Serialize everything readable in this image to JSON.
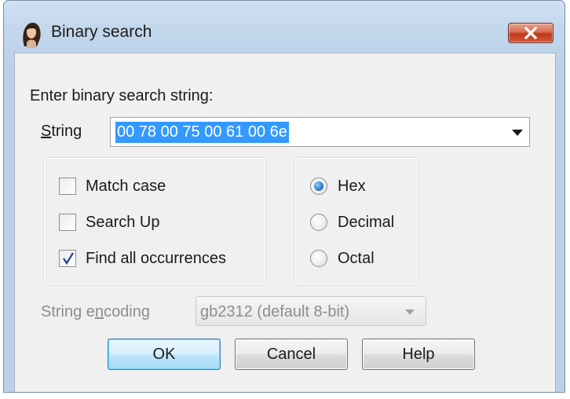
{
  "window": {
    "title": "Binary search"
  },
  "prompt": "Enter binary search string:",
  "string_field": {
    "label_underlined": "S",
    "label_rest": "tring",
    "value": "00 78 00 75 00 61 00 6e"
  },
  "options": [
    {
      "label": "Match case",
      "checked": false
    },
    {
      "label": "Search Up",
      "checked": false
    },
    {
      "label": "Find all occurrences",
      "checked": true
    }
  ],
  "format": {
    "options": [
      "Hex",
      "Decimal",
      "Octal"
    ],
    "selected": "Hex"
  },
  "encoding": {
    "label_pre": "String e",
    "label_underlined": "n",
    "label_post": "coding",
    "value": "gb2312 (default 8-bit)",
    "enabled": false
  },
  "buttons": {
    "ok": "OK",
    "cancel": "Cancel",
    "help": "Help"
  },
  "icons": {
    "app": "woman-portrait-icon",
    "close": "close-icon",
    "dropdown": "chevron-down-icon"
  }
}
